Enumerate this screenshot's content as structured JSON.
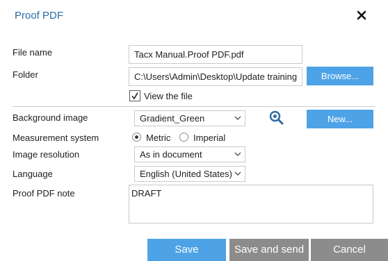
{
  "dialog": {
    "title": "Proof PDF",
    "close_icon": "close-icon"
  },
  "form": {
    "file_name_label": "File name",
    "file_name_value": "Tacx Manual.Proof PDF.pdf",
    "folder_label": "Folder",
    "folder_value": "C:\\Users\\Admin\\Desktop\\Update training",
    "browse_label": "Browse...",
    "view_file_label": "View the file",
    "view_file_checked": true,
    "background_label": "Background image",
    "background_value": "Gradient_Green",
    "preview_icon": "magnifier-icon",
    "new_label": "New...",
    "measurement_label": "Measurement system",
    "measurement_options": [
      "Metric",
      "Imperial"
    ],
    "measurement_selected": "Metric",
    "resolution_label": "Image resolution",
    "resolution_value": "As in document",
    "language_label": "Language",
    "language_value": "English (United States)",
    "note_label": "Proof PDF note",
    "note_value": "DRAFT"
  },
  "footer": {
    "save_label": "Save",
    "save_send_label": "Save and send",
    "cancel_label": "Cancel"
  },
  "colors": {
    "accent": "#4ea3e6",
    "title": "#2b6ca3",
    "secondary_button": "#8c8c8c",
    "border": "#c9c9c9"
  }
}
